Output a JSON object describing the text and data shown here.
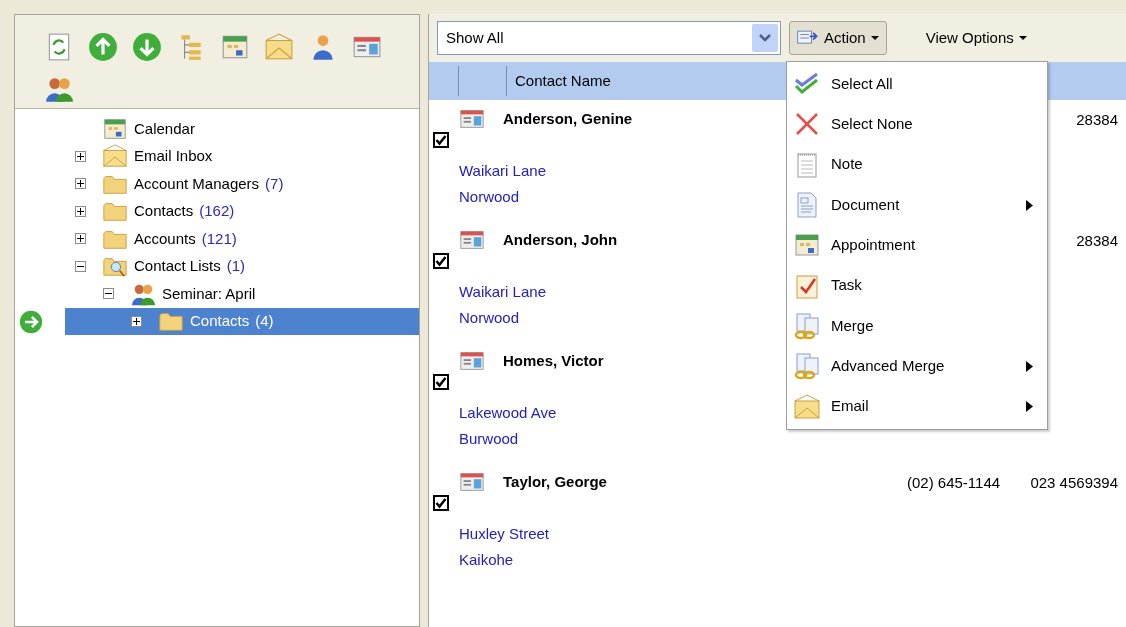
{
  "left_toolbar": {
    "buttons": [
      {
        "kind": "refresh"
      },
      {
        "kind": "up"
      },
      {
        "kind": "down"
      },
      {
        "kind": "tree"
      },
      {
        "kind": "calendar"
      },
      {
        "kind": "mail"
      },
      {
        "kind": "person"
      },
      {
        "kind": "card"
      },
      {
        "kind": "group"
      }
    ]
  },
  "tree": [
    {
      "label": "Calendar",
      "kind": "calendar",
      "has_children": false,
      "selected": false
    },
    {
      "label": "Email Inbox",
      "kind": "mail",
      "has_children": true,
      "expanded": false,
      "selected": false
    },
    {
      "label": "Account Managers",
      "count": "(7)",
      "kind": "folder",
      "has_children": true,
      "expanded": false,
      "selected": false
    },
    {
      "label": "Contacts",
      "count": "(162)",
      "kind": "folder",
      "has_children": true,
      "expanded": false,
      "selected": false
    },
    {
      "label": "Accounts",
      "count": "(121)",
      "kind": "folder",
      "has_children": true,
      "expanded": false,
      "selected": false
    },
    {
      "label": "Contact Lists",
      "count": "(1)",
      "kind": "search-folder",
      "has_children": true,
      "expanded": true,
      "selected": false,
      "children": [
        {
          "label": "Seminar: April",
          "kind": "group",
          "has_children": true,
          "expanded": true,
          "selected": false,
          "children": [
            {
              "label": "Contacts",
              "count": "(4)",
              "kind": "folder",
              "has_children": true,
              "expanded": false,
              "selected": true
            }
          ]
        }
      ]
    }
  ],
  "filter": {
    "value": "Show All"
  },
  "toolbar_buttons": [
    {
      "label": "Action",
      "kind": "action",
      "pressed": true
    },
    {
      "label": "View Options",
      "kind": "plain",
      "pressed": false
    }
  ],
  "table": {
    "columns": [
      "Contact Name"
    ],
    "rows": [
      {
        "name": "Anderson, Genine",
        "checked": true,
        "address": [
          "Waikari Lane",
          "Norwood"
        ],
        "column_4": "28384"
      },
      {
        "name": "Anderson, John",
        "checked": true,
        "address": [
          "Waikari Lane",
          "Norwood"
        ],
        "column_4": "28384"
      },
      {
        "name": "Homes, Victor",
        "checked": true,
        "address": [
          "Lakewood Ave",
          "Burwood"
        ]
      },
      {
        "name": "Taylor, George",
        "checked": true,
        "address": [
          "Huxley Street",
          "Kaikohe"
        ],
        "column_3": "(02) 645-1144",
        "column_4": "023 4569394"
      }
    ]
  },
  "action_menu": {
    "items": [
      {
        "label": "Select All",
        "kind": "select-all",
        "submenu": false
      },
      {
        "label": "Select None",
        "kind": "select-none",
        "submenu": false
      },
      {
        "label": "Note",
        "kind": "note",
        "submenu": false
      },
      {
        "label": "Document",
        "kind": "document",
        "submenu": true
      },
      {
        "label": "Appointment",
        "kind": "calendar",
        "submenu": false
      },
      {
        "label": "Task",
        "kind": "task",
        "submenu": false
      },
      {
        "label": "Merge",
        "kind": "merge",
        "submenu": false
      },
      {
        "label": "Advanced Merge",
        "kind": "merge",
        "submenu": true
      },
      {
        "label": "Email",
        "kind": "mail",
        "submenu": true
      }
    ]
  }
}
